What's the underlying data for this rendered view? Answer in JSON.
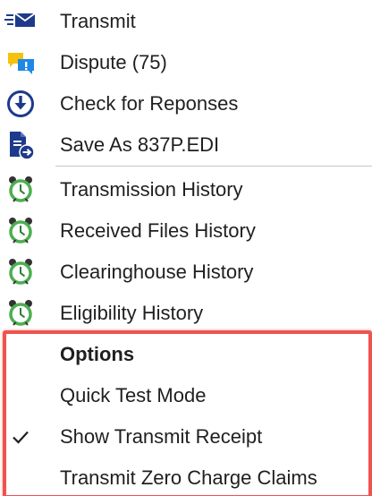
{
  "menu": {
    "items": [
      {
        "label": "Transmit",
        "icon": "transmit-icon"
      },
      {
        "label": "Dispute (75)",
        "icon": "dispute-icon"
      },
      {
        "label": "Check for Reponses",
        "icon": "download-circle-icon"
      },
      {
        "label": "Save As 837P.EDI",
        "icon": "save-file-icon"
      },
      {
        "label": "Transmission History",
        "icon": "alarm-clock-icon"
      },
      {
        "label": "Received Files History",
        "icon": "alarm-clock-icon"
      },
      {
        "label": "Clearinghouse History",
        "icon": "alarm-clock-icon"
      },
      {
        "label": "Eligibility History",
        "icon": "alarm-clock-icon"
      }
    ],
    "options": {
      "header": "Options",
      "items": [
        {
          "label": "Quick Test Mode",
          "checked": false
        },
        {
          "label": "Show Transmit Receipt",
          "checked": true
        },
        {
          "label": "Transmit Zero Charge Claims",
          "checked": false
        }
      ]
    }
  },
  "colors": {
    "highlight_border": "#ef5350",
    "icon_blue": "#1e3a8a",
    "clock_green": "#4caf50",
    "dispute_yellow": "#f4c20d",
    "dispute_blue": "#1e88e5"
  }
}
